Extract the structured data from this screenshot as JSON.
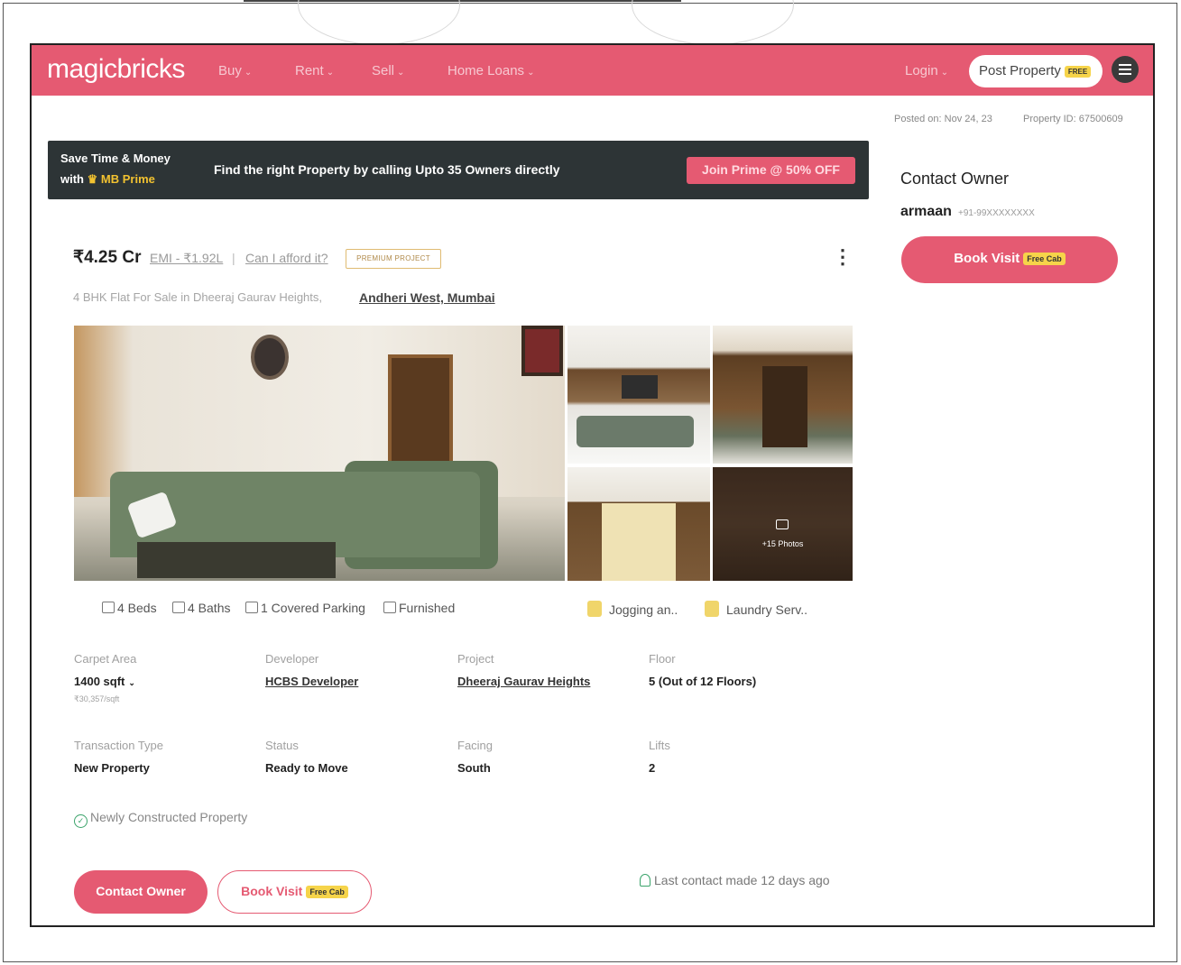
{
  "navbar": {
    "logo": "magicbricks",
    "items": [
      "Buy",
      "Rent",
      "Sell",
      "Home Loans"
    ],
    "login": "Login",
    "post_property": "Post Property",
    "post_badge": "FREE",
    "accent": "#e55a72"
  },
  "meta": {
    "posted": "Posted on: Nov 24, 23",
    "property_id": "Property ID: 67500609"
  },
  "prime_banner": {
    "line1": "Save Time & Money",
    "line2_prefix": "with",
    "line2_brand": "MB Prime",
    "message": "Find the right Property by calling Upto 35 Owners directly",
    "button": "Join Prime @ 50% OFF"
  },
  "contact_panel": {
    "title": "Contact Owner",
    "owner_name": "armaan",
    "owner_phone": "+91-99XXXXXXXX",
    "book_visit": "Book Visit",
    "free_cab": "Free Cab"
  },
  "listing": {
    "price": "₹4.25 Cr",
    "emi": "EMI - ₹1.92L",
    "separator": "|",
    "afford": "Can I afford it?",
    "premium_badge": "PREMIUM PROJECT",
    "subtitle": "4 BHK Flat For Sale in Dheeraj Gaurav Heights,",
    "location": "Andheri West, Mumbai",
    "photos_count": "+15 Photos"
  },
  "amenities": {
    "beds": "4 Beds",
    "baths": "4 Baths",
    "parking": "1 Covered Parking",
    "furnished": "Furnished",
    "jogging": "Jogging an..",
    "laundry": "Laundry Serv.."
  },
  "details": {
    "carpet_area_label": "Carpet Area",
    "carpet_area": "1400 sqft",
    "price_per_sqft": "₹30,357/sqft",
    "developer_label": "Developer",
    "developer": "HCBS Developer",
    "project_label": "Project",
    "project": "Dheeraj Gaurav Heights",
    "floor_label": "Floor",
    "floor": "5 (Out of 12 Floors)",
    "transaction_label": "Transaction Type",
    "transaction": "New Property",
    "status_label": "Status",
    "status": "Ready to Move",
    "facing_label": "Facing",
    "facing": "South",
    "lifts_label": "Lifts",
    "lifts": "2"
  },
  "footer": {
    "newly": "Newly Constructed Property",
    "contact_owner": "Contact Owner",
    "book_visit": "Book Visit",
    "free_cab": "Free Cab",
    "last_contact": "Last contact made 12 days ago"
  }
}
